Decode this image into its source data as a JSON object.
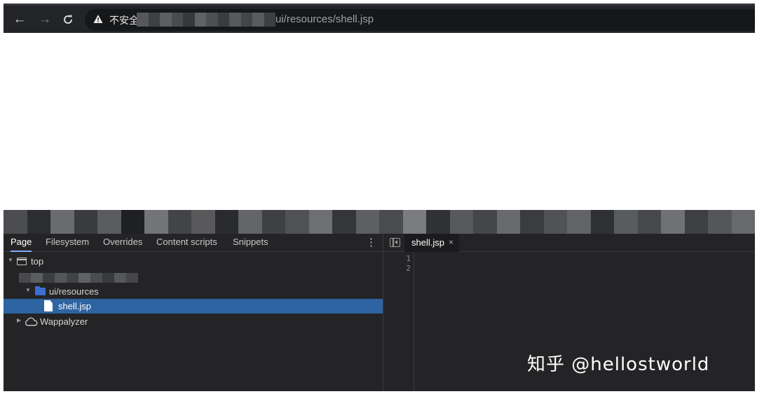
{
  "browser": {
    "security_label": "不安全",
    "url_visible": "ui/resources/shell.jsp",
    "icons": {
      "back": "arrow-left-icon",
      "forward": "arrow-right-icon",
      "reload": "reload-icon",
      "security": "warning-icon"
    },
    "mosaic_colors": [
      "#56575a",
      "#3f4043",
      "#5d5e61",
      "#4a4b4e",
      "#37383b",
      "#606164",
      "#4e4f52",
      "#3b3c3f",
      "#58595c",
      "#444548",
      "#5a5b5e",
      "#3d3e41"
    ]
  },
  "banner": {
    "mosaic_colors": [
      "#4c4d50",
      "#2c2d30",
      "#6a6b6e",
      "#3a3b3e",
      "#5b5c5f",
      "#1f2023",
      "#737477",
      "#434447",
      "#59595c",
      "#2a2b2e",
      "#646568",
      "#3f4043",
      "#505154",
      "#6e6f72",
      "#353639",
      "#5e5f62",
      "#4a4b4e",
      "#7a7b7e",
      "#303134",
      "#58595c",
      "#454649",
      "#696a6d",
      "#3b3c3f",
      "#515255",
      "#626366",
      "#2f3033",
      "#5a5b5e",
      "#47484b",
      "#707174",
      "#3e3f42",
      "#55565a",
      "#68696c"
    ]
  },
  "devtools": {
    "navigator_tabs": [
      "Page",
      "Filesystem",
      "Overrides",
      "Content scripts",
      "Snippets"
    ],
    "active_tab": "Page",
    "tree": {
      "top": "top",
      "folder": "ui/resources",
      "file": "shell.jsp",
      "extension": "Wappalyzer",
      "masked_colors": [
        "#48494c",
        "#5c5d60",
        "#3c3d40",
        "#55565a",
        "#424346",
        "#606164",
        "#4b4c4f",
        "#393a3d",
        "#56575a",
        "#45464a"
      ]
    },
    "editor": {
      "open_file": "shell.jsp",
      "close_glyph": "×",
      "line_numbers": [
        "1",
        "2"
      ]
    }
  },
  "watermark": "知乎 @hellostworld"
}
